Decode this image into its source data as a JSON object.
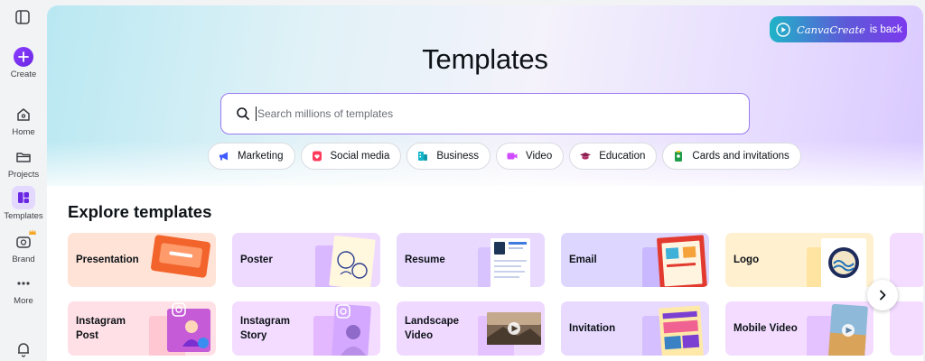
{
  "sidebar": {
    "items": [
      {
        "label": "Create"
      },
      {
        "label": "Home"
      },
      {
        "label": "Projects"
      },
      {
        "label": "Templates"
      },
      {
        "label": "Brand"
      },
      {
        "label": "More"
      }
    ]
  },
  "promo": {
    "brand": "CanvaCreate",
    "rest": "is back"
  },
  "page": {
    "title": "Templates"
  },
  "search": {
    "placeholder": "Search millions of templates"
  },
  "chips": [
    {
      "label": "Marketing",
      "icon": "megaphone-icon"
    },
    {
      "label": "Social media",
      "icon": "heart-badge-icon"
    },
    {
      "label": "Business",
      "icon": "briefcase-icon"
    },
    {
      "label": "Video",
      "icon": "video-camera-icon"
    },
    {
      "label": "Education",
      "icon": "graduation-cap-icon"
    },
    {
      "label": "Cards and invitations",
      "icon": "card-icon"
    }
  ],
  "explore": {
    "title": "Explore templates",
    "row1": [
      {
        "label": "Presentation",
        "color": "#ffe3d6"
      },
      {
        "label": "Poster",
        "color": "#eed9ff"
      },
      {
        "label": "Resume",
        "color": "#e9d9ff"
      },
      {
        "label": "Email",
        "color": "#ddd6ff"
      },
      {
        "label": "Logo",
        "color": "#fff0cf"
      }
    ],
    "row2": [
      {
        "label": "Instagram Post",
        "color": "#ffe0e6"
      },
      {
        "label": "Instagram Story",
        "color": "#f3dcff"
      },
      {
        "label": "Landscape Video",
        "color": "#f0d9ff"
      },
      {
        "label": "Invitation",
        "color": "#e8d9ff"
      },
      {
        "label": "Mobile Video",
        "color": "#f3dcff"
      }
    ]
  },
  "colors": {
    "accent": "#8b3dff",
    "border": "#9b7bf0"
  }
}
